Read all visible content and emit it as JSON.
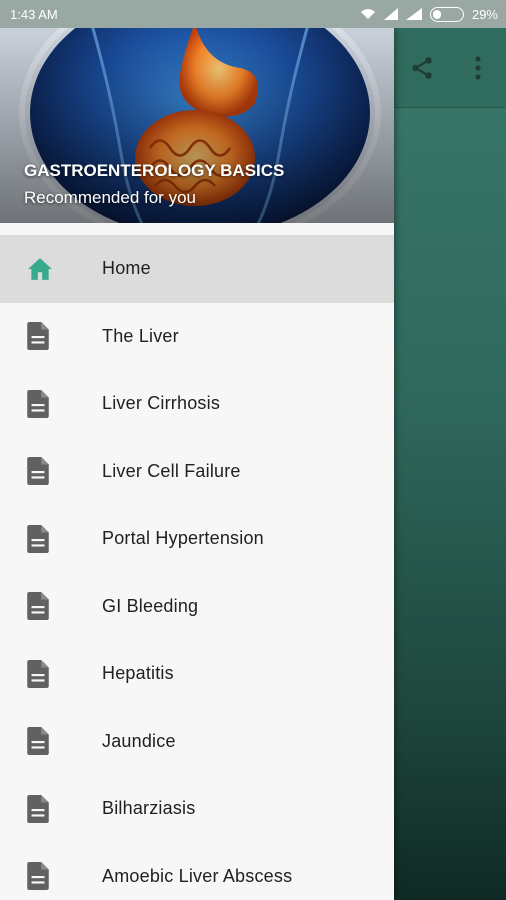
{
  "status_bar": {
    "time": "1:43 AM",
    "battery_percent": "29%",
    "battery_level": 0.29
  },
  "toolbar": {
    "share_icon": "share-icon",
    "more_icon": "more-vert-icon"
  },
  "drawer": {
    "header": {
      "title": "GASTROENTEROLOGY BASICS",
      "subtitle": "Recommended for you"
    },
    "items": [
      {
        "label": "Home",
        "icon": "home-icon",
        "active": true
      },
      {
        "label": "The Liver",
        "icon": "document-icon"
      },
      {
        "label": "Liver Cirrhosis",
        "icon": "document-icon"
      },
      {
        "label": "Liver Cell Failure",
        "icon": "document-icon"
      },
      {
        "label": "Portal Hypertension",
        "icon": "document-icon"
      },
      {
        "label": "GI Bleeding",
        "icon": "document-icon"
      },
      {
        "label": "Hepatitis",
        "icon": "document-icon"
      },
      {
        "label": "Jaundice",
        "icon": "document-icon"
      },
      {
        "label": "Bilharziasis",
        "icon": "document-icon"
      },
      {
        "label": "Amoebic Liver Abscess",
        "icon": "document-icon"
      }
    ]
  },
  "colors": {
    "accent": "#3aaa8f",
    "icon": "#616161",
    "toolbar": "#2f6c5e"
  }
}
